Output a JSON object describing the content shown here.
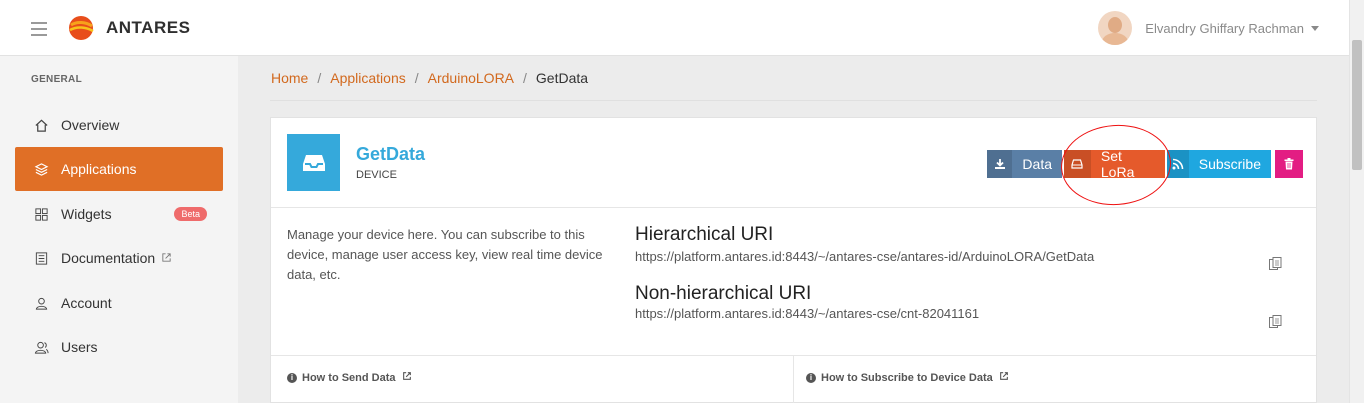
{
  "app": {
    "name": "ANTARES"
  },
  "user": {
    "name": "Elvandry Ghiffary Rachman"
  },
  "sidebar": {
    "section": "GENERAL",
    "items": [
      {
        "label": "Overview",
        "icon": "home-icon"
      },
      {
        "label": "Applications",
        "icon": "layers-icon",
        "active": true
      },
      {
        "label": "Widgets",
        "icon": "grid-icon",
        "badge": "Beta"
      },
      {
        "label": "Documentation",
        "icon": "book-icon",
        "external": true
      },
      {
        "label": "Account",
        "icon": "user-icon"
      },
      {
        "label": "Users",
        "icon": "users-icon"
      }
    ]
  },
  "breadcrumb": {
    "home": "Home",
    "applications": "Applications",
    "app": "ArduinoLORA",
    "current": "GetData"
  },
  "device": {
    "title": "GetData",
    "type": "DEVICE",
    "description": "Manage your device here. You can subscribe to this device, manage user access key, view real time device data, etc."
  },
  "buttons": {
    "data": "Data",
    "lora": "Set LoRa",
    "subscribe": "Subscribe"
  },
  "uris": {
    "hierarchical_title": "Hierarchical URI",
    "hierarchical_value": "https://platform.antares.id:8443/~/antares-cse/antares-id/ArduinoLORA/GetData",
    "nonhierarchical_title": "Non-hierarchical URI",
    "nonhierarchical_value": "https://platform.antares.id:8443/~/antares-cse/cnt-82041161"
  },
  "footer": {
    "send": "How to Send Data",
    "subscribe": "How to Subscribe to Device Data"
  },
  "colors": {
    "accent": "#e06f26",
    "device": "#35a9db",
    "data_btn": "#5a7fa6",
    "lora_btn": "#e55a2b",
    "subscribe_btn": "#1fa7e0",
    "delete_btn": "#e31d83",
    "annotation": "#ee1111"
  }
}
